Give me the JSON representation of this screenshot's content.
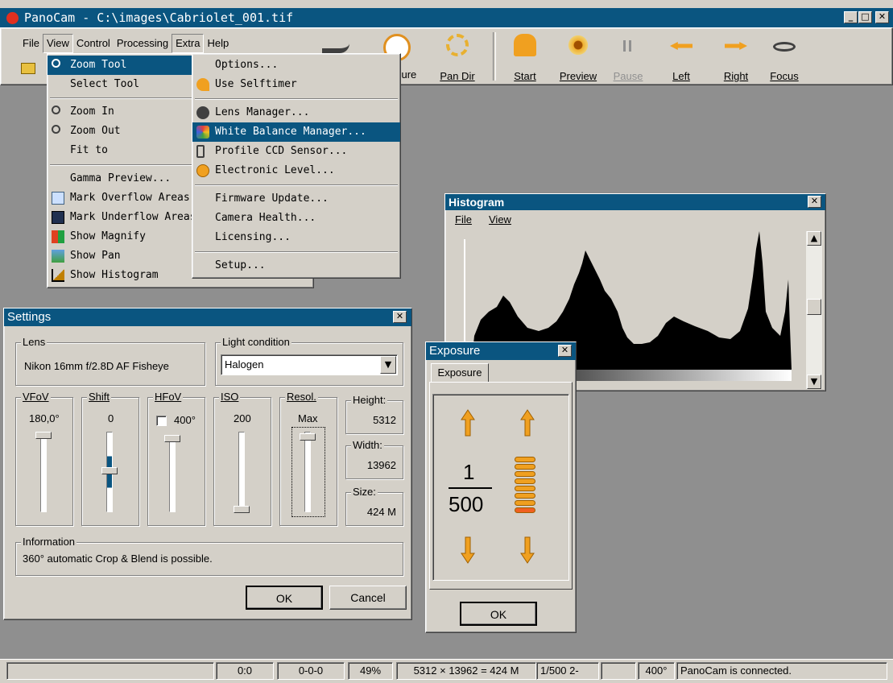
{
  "window": {
    "title": "PanoCam - C:\\images\\Cabriolet_001.tif",
    "controls": {
      "minimize": "_",
      "maximize": "□",
      "close": "✕"
    }
  },
  "menubar": [
    "File",
    "View",
    "Control",
    "Processing",
    "Extra",
    "Help"
  ],
  "toolbar": {
    "partial_label": "sure",
    "buttons": [
      "Pan Dir",
      "Start",
      "Preview",
      "Pause",
      "Left",
      "Right",
      "Focus"
    ]
  },
  "view_menu": {
    "items": [
      "Zoom Tool",
      "Select Tool",
      "Zoom In",
      "Zoom Out",
      "Fit to",
      "Gamma Preview...",
      "Mark Overflow Areas",
      "Mark Underflow Areas",
      "Show Magnify",
      "Show Pan",
      "Show Histogram"
    ]
  },
  "extra_menu": {
    "items": [
      "Options...",
      "Use Selftimer",
      "Lens Manager...",
      "White Balance Manager...",
      "Profile CCD Sensor...",
      "Electronic Level...",
      "Firmware Update...",
      "Camera Health...",
      "Licensing...",
      "Setup..."
    ]
  },
  "histogram": {
    "title": "Histogram",
    "menu": [
      "File",
      "View"
    ],
    "close": "✕"
  },
  "settings": {
    "title": "Settings",
    "close": "✕",
    "lens": {
      "label": "Lens",
      "value": "Nikon 16mm f/2.8D AF Fisheye"
    },
    "light": {
      "label": "Light condition",
      "value": "Halogen"
    },
    "vfov": {
      "label": "VFoV",
      "value": "180,0°"
    },
    "shift": {
      "label": "Shift",
      "value": "0"
    },
    "hfov": {
      "label": "HFoV",
      "value": "400°"
    },
    "iso": {
      "label": "ISO",
      "value": "200"
    },
    "resol": {
      "label": "Resol.",
      "value": "Max"
    },
    "height": {
      "label": "Height:",
      "value": "5312"
    },
    "width": {
      "label": "Width:",
      "value": "13962"
    },
    "size": {
      "label": "Size:",
      "value": "424 M"
    },
    "info": {
      "label": "Information",
      "value": "360° automatic Crop & Blend is possible."
    },
    "ok": "OK",
    "cancel": "Cancel"
  },
  "exposure": {
    "title": "Exposure",
    "close": "✕",
    "tab": "Exposure",
    "numerator": "1",
    "denominator": "500",
    "ok": "OK",
    "level_steps": 8,
    "level_active": 1
  },
  "statusbar": [
    "0:0",
    "0-0-0",
    "49%",
    "5312 × 13962 = 424 M",
    "1/500  2-",
    "",
    "400°",
    "PanoCam is connected."
  ],
  "colors": {
    "title": "#0a5580",
    "face": "#d4d0c8",
    "desktop": "#8f8f8f",
    "accent": "#f0a020",
    "level_active": "#f06020"
  }
}
